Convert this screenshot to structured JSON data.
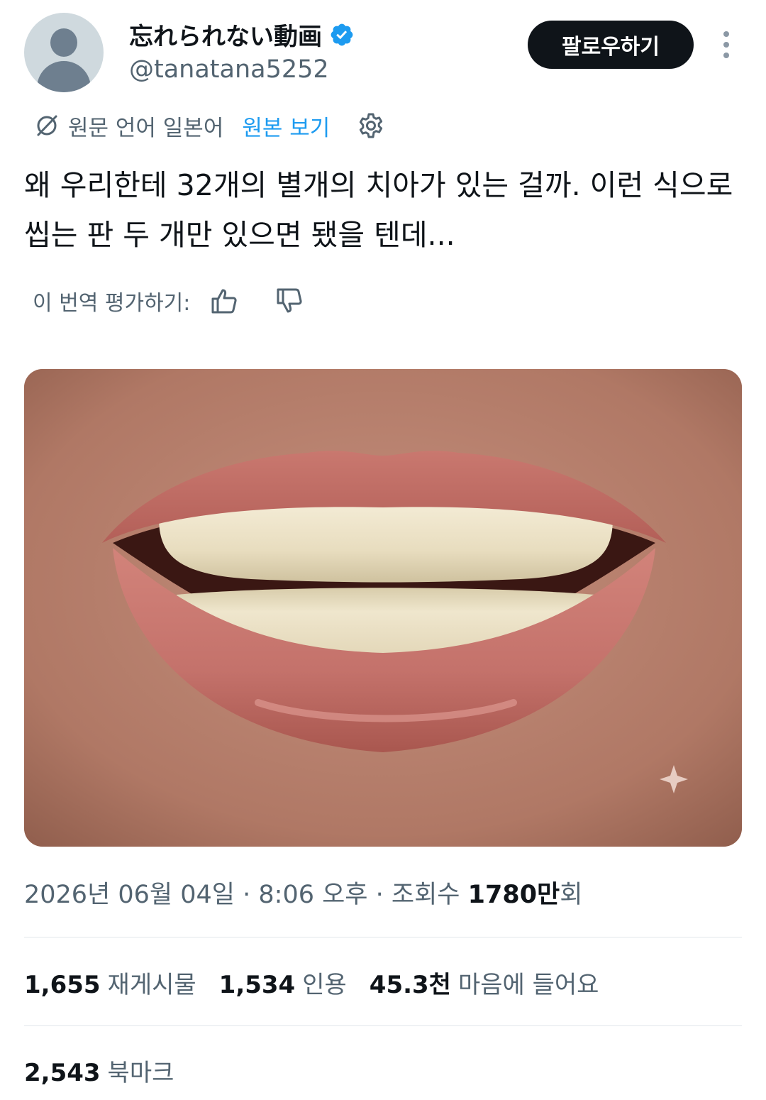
{
  "author": {
    "display_name": "忘れられない動画",
    "handle": "@tanatana5252",
    "verified_icon": "verified-badge-icon",
    "avatar_icon": "default-avatar-icon"
  },
  "follow_label": "팔로우하기",
  "translation": {
    "source_label": "원문 언어 일본어",
    "show_original_label": "원본 보기"
  },
  "tweet_text": "왜 우리한테 32개의 별개의 치아가 있는 걸까. 이런 식으로 씹는 판 두 개만 있으면 됐을 텐데...",
  "rate_translation_label": "이 번역 평가하기:",
  "meta": {
    "date": "2026년 06월 04일",
    "sep1": " · ",
    "time": "8:06 오후",
    "sep2": " · ",
    "views_label": "조회수 ",
    "views_value": "1780만",
    "views_suffix": "회"
  },
  "stats": {
    "retweets_value": "1,655",
    "retweets_label": "재게시물",
    "quotes_value": "1,534",
    "quotes_label": "인용",
    "likes_value": "45.3천",
    "likes_label": "마음에 들어요",
    "bookmarks_value": "2,543",
    "bookmarks_label": "북마크"
  },
  "colors": {
    "accent": "#1d9bf0",
    "text": "#0f1419",
    "secondary": "#536471",
    "button_bg": "#0f1419"
  }
}
